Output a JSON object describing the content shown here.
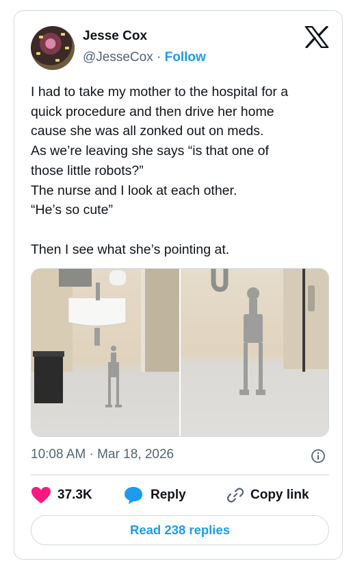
{
  "author": {
    "name": "Jesse Cox",
    "handle": "@JesseCox",
    "separator": "·",
    "follow_label": "Follow",
    "avatar_icon": "avatar-photo"
  },
  "brand": {
    "logo_icon": "x-logo-icon"
  },
  "tweet": {
    "lines": [
      "I had to take my mother to the hospital for a",
      "quick procedure and then drive her home",
      "cause she was all zonked out on meds.",
      "As we’re leaving she says “is that one of",
      "those little robots?”",
      "The nurse and I look at each other.",
      "“He’s so cute”",
      "",
      "Then I see what she’s pointing at."
    ],
    "media": [
      {
        "icon": "photo-sink-and-robot-figure"
      },
      {
        "icon": "photo-robot-figure-closeup"
      }
    ],
    "timestamp": "10:08 AM · Mar 18, 2026"
  },
  "actions": {
    "likes": "37.3K",
    "reply_label": "Reply",
    "copy_link_label": "Copy link",
    "read_replies_label": "Read 238 replies"
  },
  "colors": {
    "accent": "#1d9bf0",
    "like": "#f91880",
    "text": "#0f1419",
    "muted": "#536471",
    "border": "#cfd9de"
  }
}
